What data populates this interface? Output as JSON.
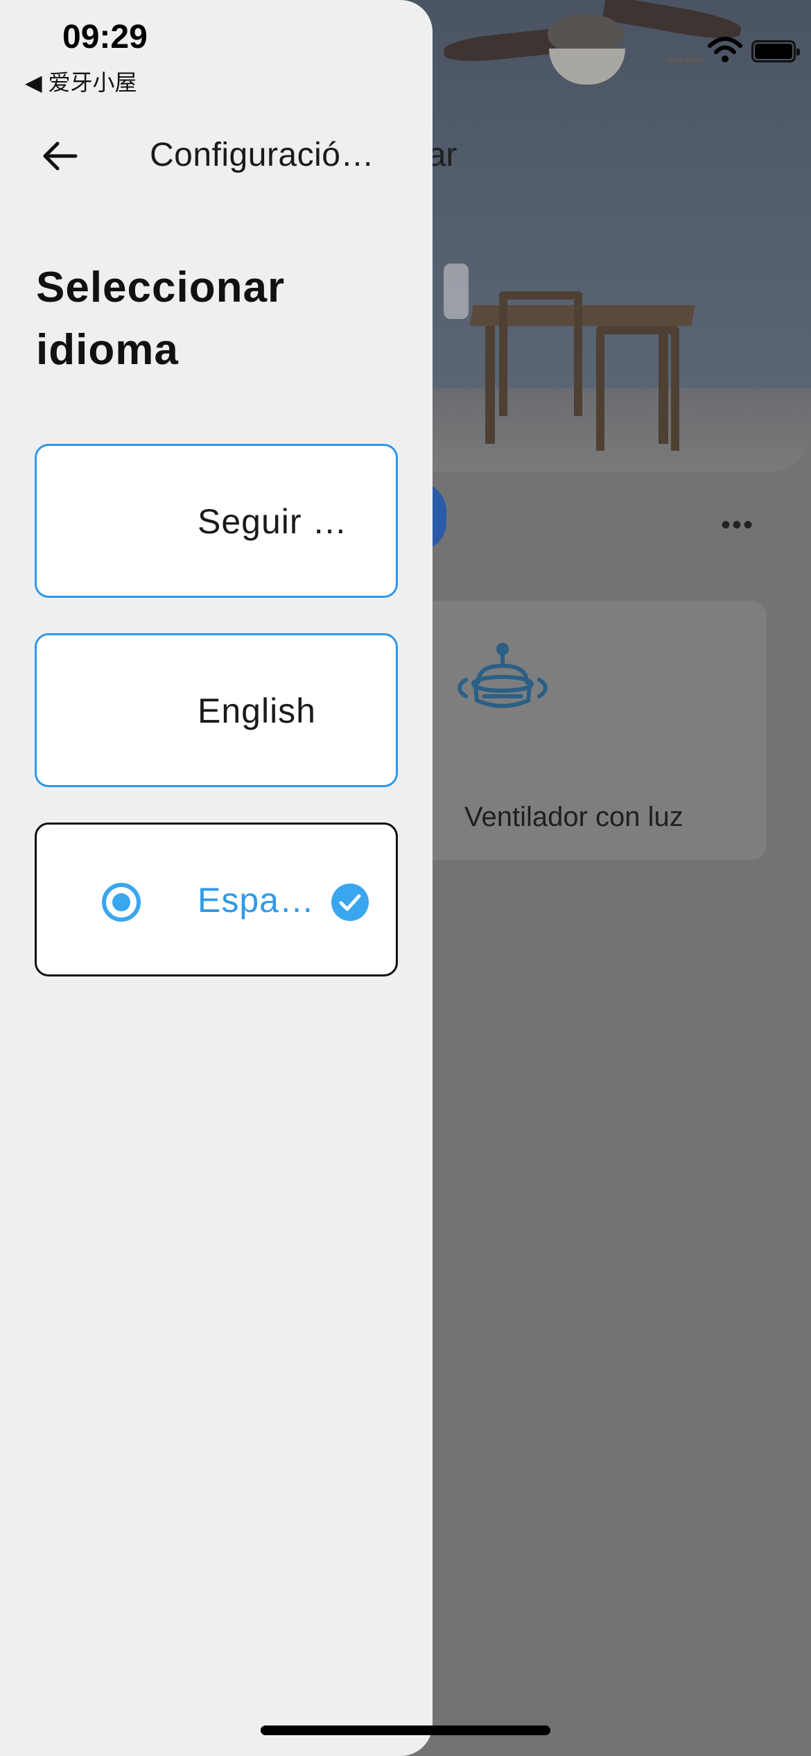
{
  "status_bar": {
    "time": "09:29",
    "back_app": "◀ 爱牙小屋"
  },
  "drawer": {
    "back_icon": "arrow-left-icon",
    "title": "Configuració…",
    "heading": "Seleccionar idioma",
    "options": [
      {
        "label": "Seguir i…",
        "selected": false
      },
      {
        "label": "English",
        "selected": false
      },
      {
        "label": "Españ…",
        "selected": true
      }
    ]
  },
  "background": {
    "title_fragment": "gar",
    "more_label": "•••",
    "card_label": "Ventilador con luz",
    "card_icon": "ceiling-fan-icon"
  },
  "colors": {
    "accent": "#2f96e6",
    "selected_text": "#2f9ae8",
    "drawer_bg": "#efefef",
    "scrim": "#737373"
  }
}
